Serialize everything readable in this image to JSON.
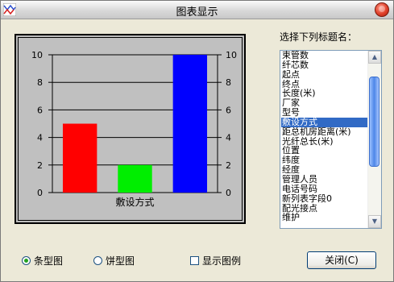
{
  "window": {
    "title": "图表显示"
  },
  "list": {
    "label": "选择下列标题名：",
    "items": [
      "束管数",
      "纤芯数",
      "起点",
      "终点",
      "长度(米)",
      "厂家",
      "型号",
      "敷设方式",
      "距总机房距离(米)",
      "光纤总长(米)",
      "位置",
      "纬度",
      "经度",
      "管理人员",
      "电话号码",
      "新列表字段0",
      "配光接点",
      "维护"
    ],
    "selected_index": 7
  },
  "options": {
    "bar_label": "条型图",
    "pie_label": "饼型图",
    "bar_selected": true,
    "pie_selected": false,
    "legend_label": "显示图例",
    "legend_checked": false
  },
  "buttons": {
    "close_label": "关闭(C)"
  },
  "colors": {
    "bar1": "#ff0000",
    "bar2": "#00ee00",
    "bar3": "#0000ff",
    "plot_bg": "#c0c0c0",
    "selection": "#316ac5"
  },
  "chart_data": {
    "type": "bar",
    "categories": [
      "敷设方式"
    ],
    "values": [
      5,
      2,
      10
    ],
    "bar_colors": [
      "#ff0000",
      "#00ee00",
      "#0000ff"
    ],
    "ylim": [
      0,
      10
    ],
    "yticks": [
      "0",
      "2",
      "4",
      "6",
      "8",
      "10"
    ],
    "right_yticks": [
      "0",
      "2",
      "4",
      "6",
      "8",
      "10"
    ],
    "grid": true
  }
}
